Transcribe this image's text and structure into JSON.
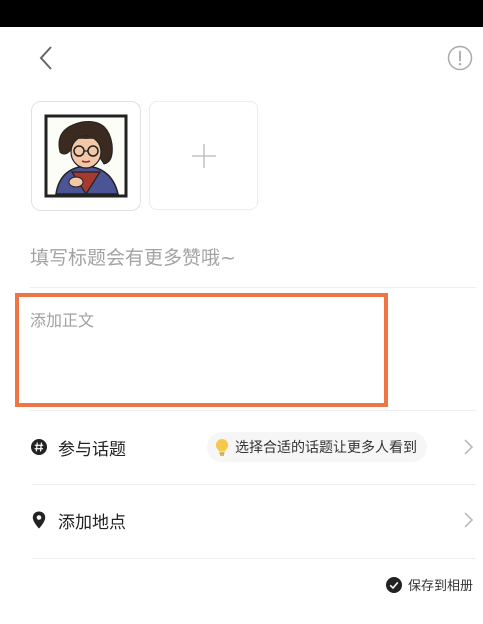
{
  "note": {
    "title_placeholder": "填写标题会有更多赞哦~",
    "body_placeholder": "添加正文"
  },
  "options": {
    "topic_label": "参与话题",
    "topic_tip": "选择合适的话题让更多人看到",
    "location_label": "添加地点"
  },
  "footer": {
    "save_label": "保存到相册"
  },
  "colors": {
    "highlight": "#ee7546",
    "placeholder": "#a3a3a3",
    "bulb": "#f7c94b"
  },
  "icons": {
    "back": "chevron-left",
    "info": "exclamation-circle",
    "add": "plus",
    "topic": "hash",
    "location": "map-pin",
    "save": "check-circle"
  }
}
